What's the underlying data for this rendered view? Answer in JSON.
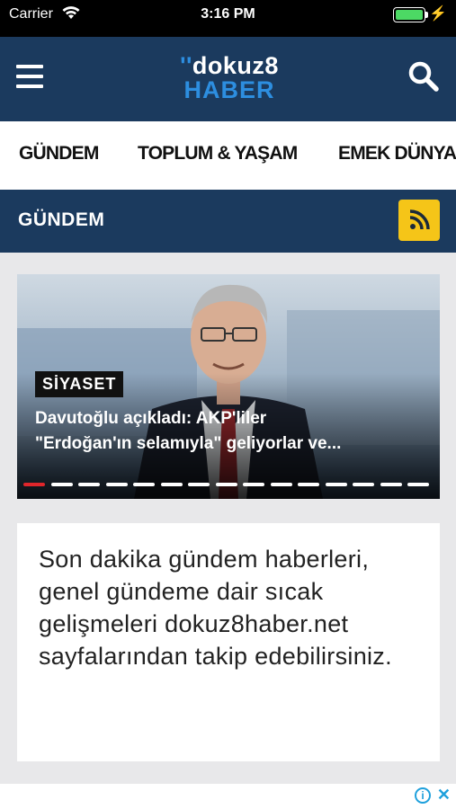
{
  "status_bar": {
    "carrier": "Carrier",
    "time": "3:16 PM",
    "battery_level": 1.0,
    "icons": [
      "wifi-icon",
      "battery-icon",
      "charging-icon"
    ]
  },
  "header": {
    "logo_top": "dokuz8",
    "logo_quote": "''",
    "logo_bottom": "HABER",
    "icons": [
      "menu-icon",
      "search-icon"
    ]
  },
  "categories": [
    "GÜNDEM",
    "TOPLUM & YAŞAM",
    "EMEK DÜNYASI"
  ],
  "section": {
    "title": "GÜNDEM",
    "icon": "rss-icon"
  },
  "slider": {
    "tag": "SİYASET",
    "headline_line1": "Davutoğlu açıkladı: AKP'liler",
    "headline_line2": "\"Erdoğan'ın selamıyla\" geliyorlar ve...",
    "slide_count": 15,
    "active_slide": 0
  },
  "description": {
    "text": "Son dakika gündem haberleri, genel gündeme dair sıcak gelişmeleri dokuz8haber.net sayfalarından takip edebilirsiniz."
  },
  "ad": {
    "info_icon": "info-icon",
    "close_icon": "close-icon",
    "info_symbol": "i",
    "close_symbol": "✕"
  },
  "colors": {
    "navy": "#1b3a5e",
    "accent_blue": "#2d8ee0",
    "rss_yellow": "#f5c518",
    "active_dot": "#e0262b"
  }
}
